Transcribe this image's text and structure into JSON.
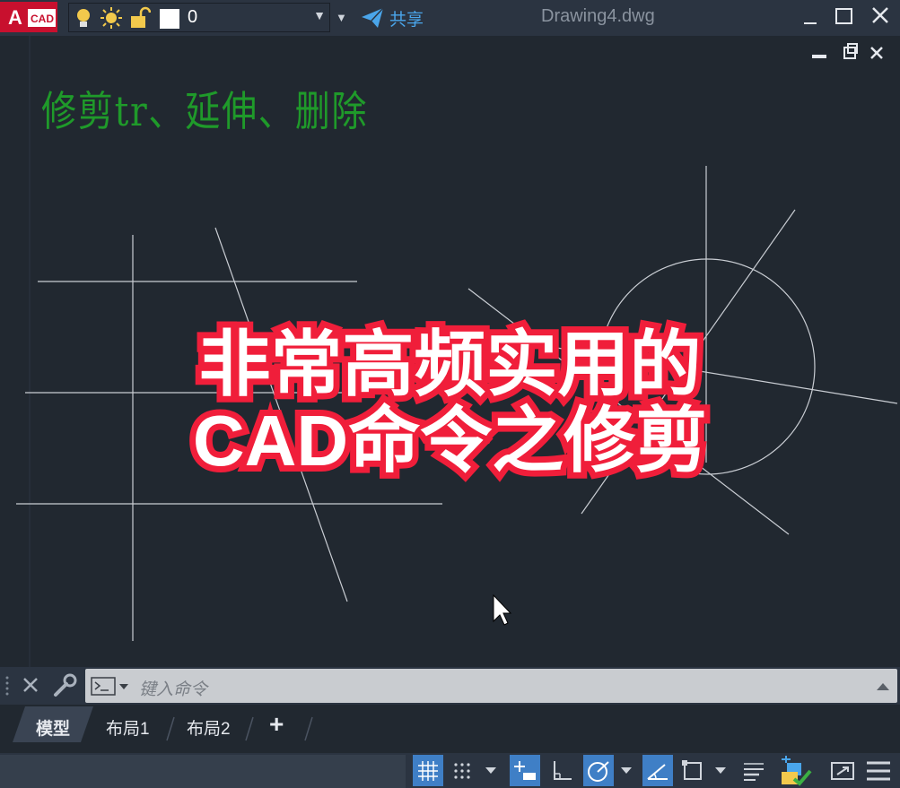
{
  "app": {
    "logo_letter": "A",
    "logo_text": "CAD",
    "document_title": "Drawing4.dwg"
  },
  "layer": {
    "name": "0",
    "color": "#ffffff"
  },
  "share": {
    "label": "共享"
  },
  "canvas": {
    "annotation": "修剪tr、延伸、删除",
    "overlay_line1": "非常高频实用的",
    "overlay_line2": "CAD命令之修剪"
  },
  "command": {
    "placeholder": "键入命令"
  },
  "tabs": {
    "model": "模型",
    "layout1": "布局1",
    "layout2": "布局2",
    "add": "+"
  },
  "colors": {
    "accent": "#3f7fc6",
    "share_blue": "#4aa5ea",
    "overlay_stroke": "#f01e3a",
    "annotation_green": "#1f9a2a",
    "logo_red": "#c8102e"
  }
}
